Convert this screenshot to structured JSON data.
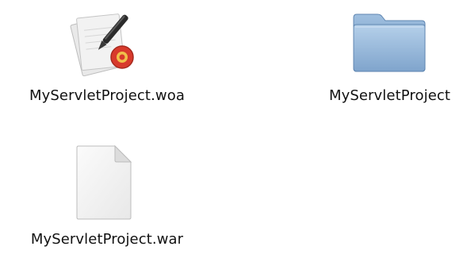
{
  "files": [
    {
      "name": "MyServletProject.woa",
      "kind": "woa-bundle-icon"
    },
    {
      "name": "MyServletProject",
      "kind": "folder-icon"
    },
    {
      "name": "MyServletProject.war",
      "kind": "document-icon"
    }
  ],
  "colors": {
    "folder_blue": "#8fb3d9",
    "badge_red": "#d83a2c",
    "label_text": "#111111"
  }
}
